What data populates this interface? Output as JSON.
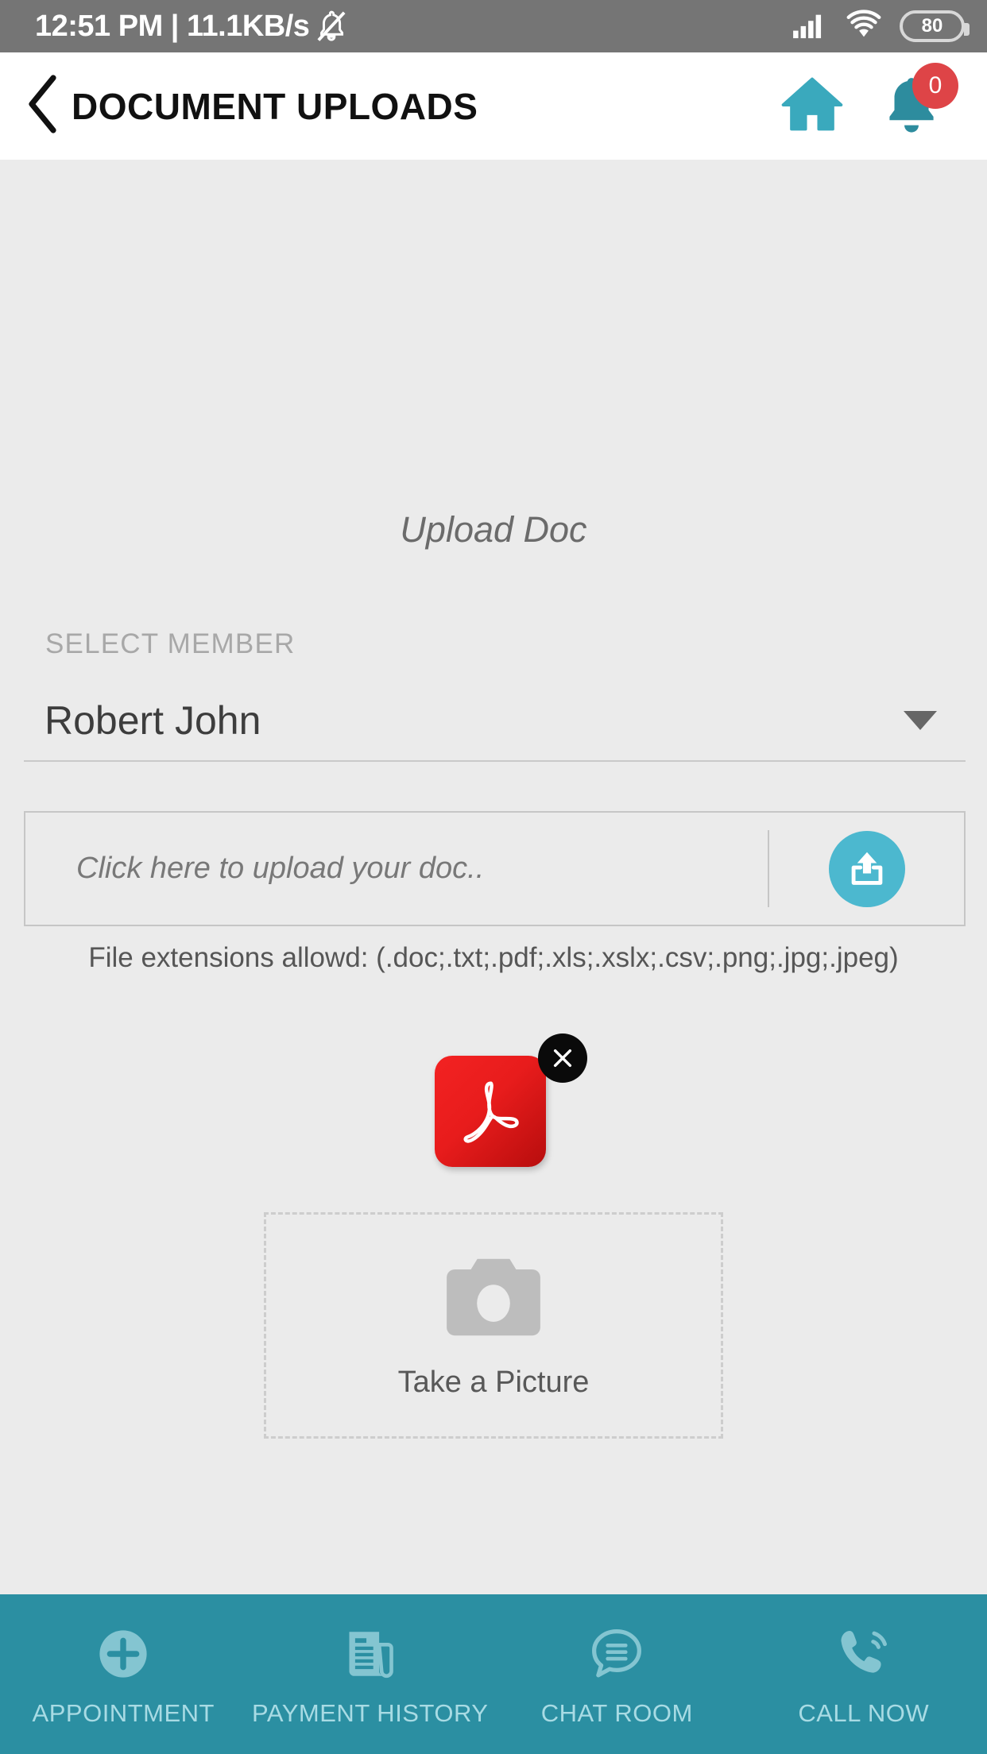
{
  "status_bar": {
    "clock": "12:51 PM | 11.1KB/s",
    "mute_icon": "bell-muted-icon",
    "signal_icon": "signal-bars-icon",
    "wifi_icon": "wifi-icon",
    "battery_level": "80",
    "background_color": "#757575"
  },
  "header": {
    "back_icon": "chevron-left-icon",
    "title": "DOCUMENT UPLOADS",
    "home_icon": "home-icon",
    "bell_icon": "bell-icon",
    "notification_count": "0",
    "badge_color": "#de4447",
    "accent_color": "#3aa9bd",
    "background_color": "#ffffff"
  },
  "main": {
    "section_title": "Upload Doc",
    "member_field": {
      "label": "SELECT MEMBER",
      "value": "Robert John",
      "caret_icon": "chevron-down-icon"
    },
    "upload_field": {
      "placeholder": "Click here to upload  your doc..",
      "button_icon": "upload-icon",
      "button_color": "#4cb8cf",
      "hint": "File extensions allowd: (.doc;.txt;.pdf;.xls;.xslx;.csv;.png;.jpg;.jpeg)"
    },
    "attachment": {
      "file_icon": "pdf-file-icon",
      "file_color": "#e81c1c",
      "remove_icon": "close-icon"
    },
    "camera_field": {
      "icon": "camera-icon",
      "label": "Take a Picture"
    },
    "background_color": "#ebebeb"
  },
  "bottom_nav": {
    "background_color": "#2b8fa2",
    "label_color": "#a8dbe4",
    "items": [
      {
        "label": "APPOINTMENT",
        "icon": "plus-circle-icon"
      },
      {
        "label": "PAYMENT HISTORY",
        "icon": "receipt-icon"
      },
      {
        "label": "CHAT ROOM",
        "icon": "chat-bubble-icon"
      },
      {
        "label": "CALL NOW",
        "icon": "phone-call-icon"
      }
    ]
  }
}
